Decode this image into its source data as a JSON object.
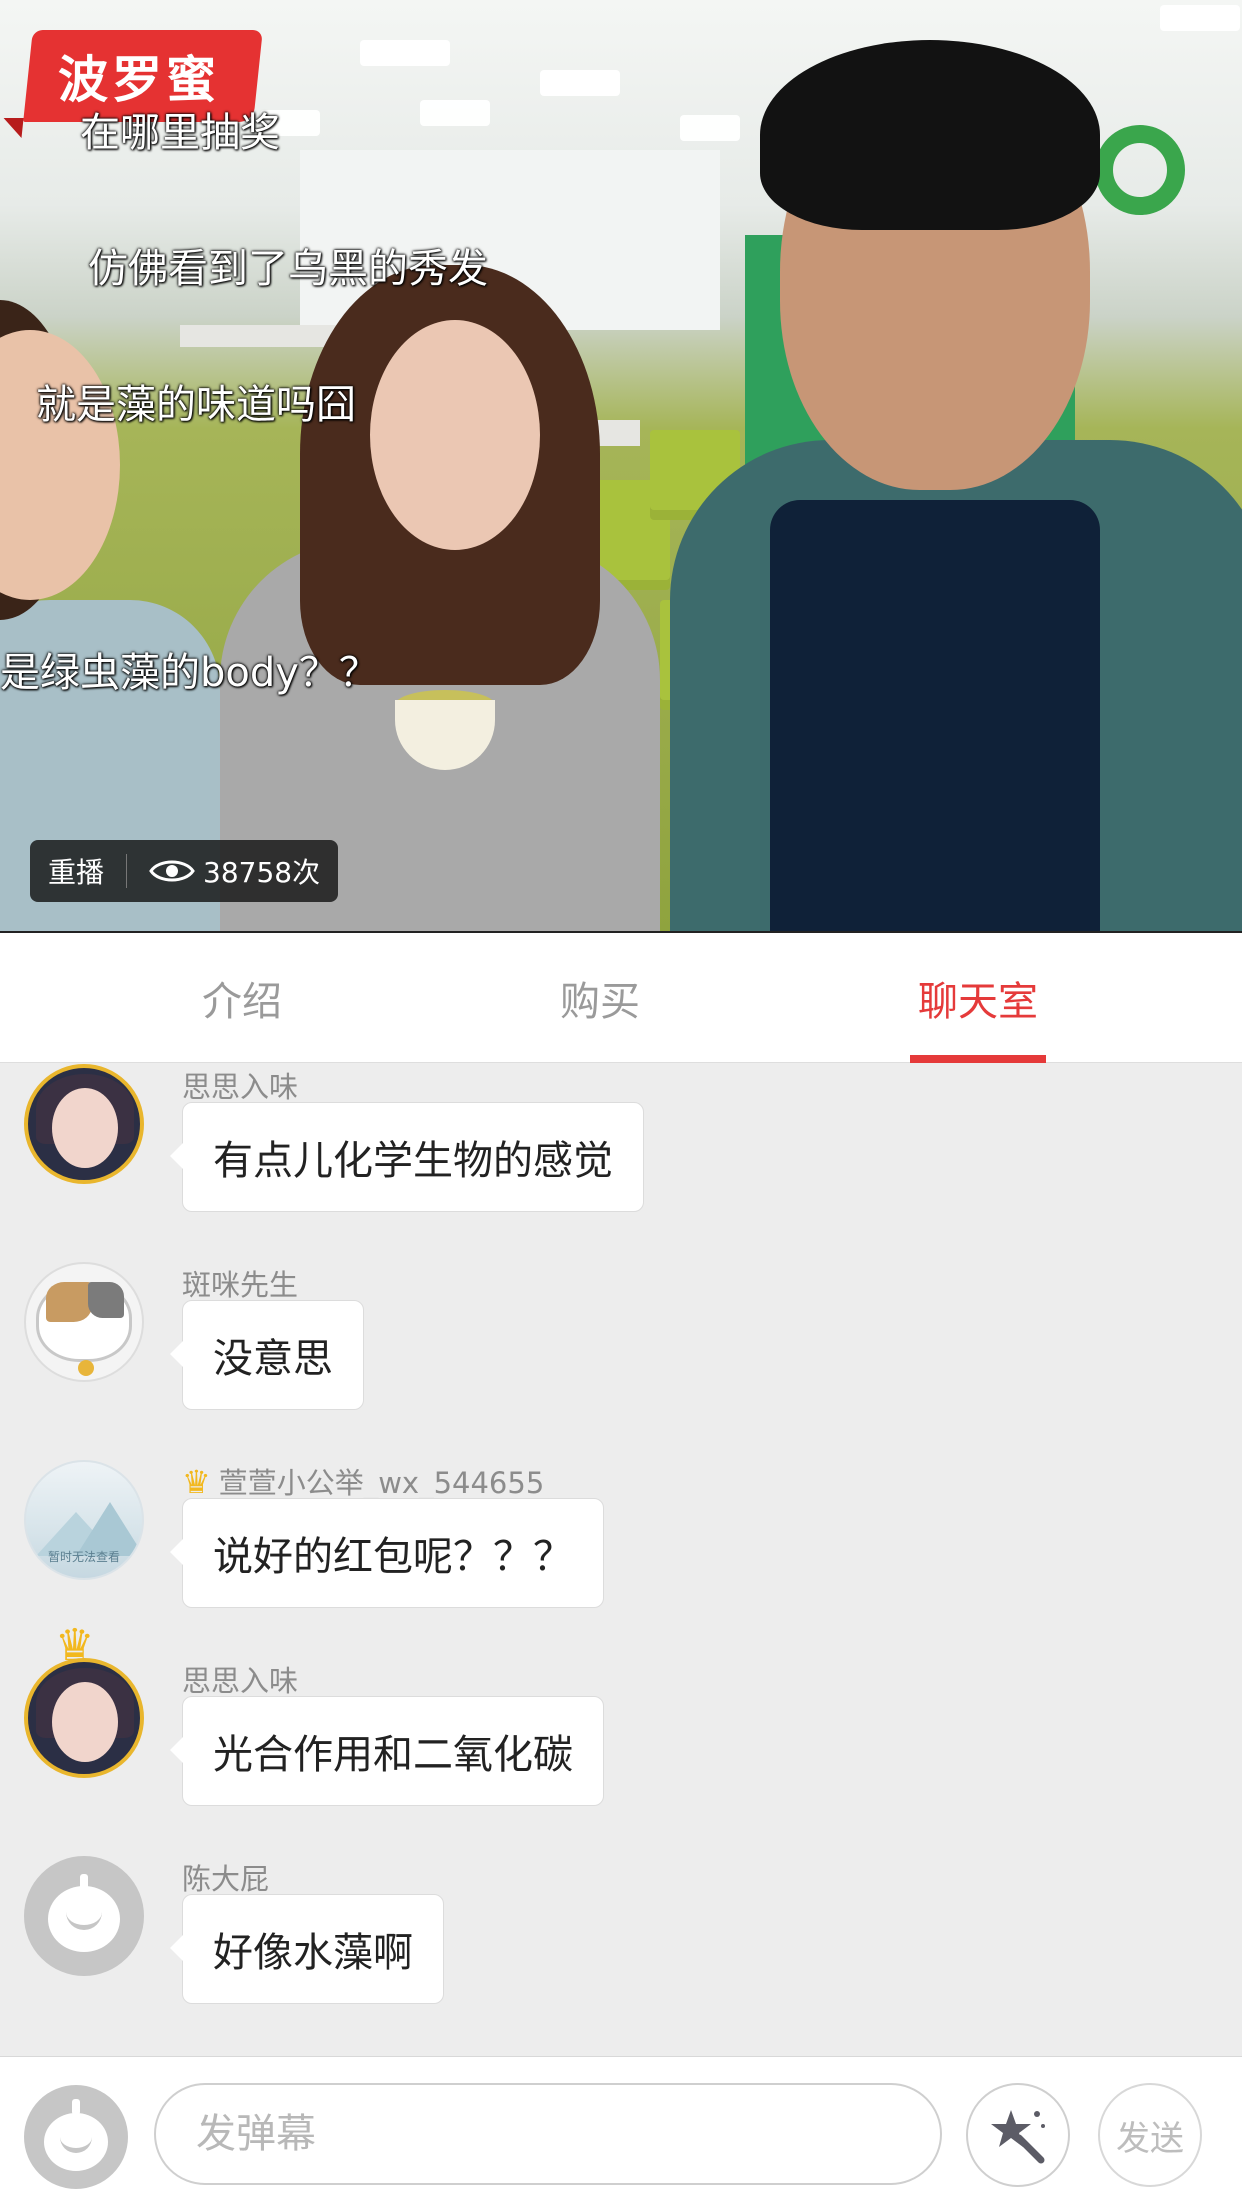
{
  "video": {
    "logo_text": "波罗蜜",
    "danmaku": [
      "在哪里抽奖",
      "仿佛看到了乌黑的秀发",
      "就是藻的味道吗囧",
      "是绿虫藻的body？？"
    ],
    "replay_label": "重播",
    "view_count": "38758次"
  },
  "tabs": [
    {
      "label": "介绍",
      "active": false
    },
    {
      "label": "购买",
      "active": false
    },
    {
      "label": "聊天室",
      "active": true
    }
  ],
  "accent_color": "#e53a3a",
  "chat": {
    "messages": [
      {
        "user": "思思入味",
        "text": "有点儿化学生物的感觉",
        "avatar": "gold-frame-user-avatar"
      },
      {
        "user": "斑咪先生",
        "text": "没意思",
        "avatar": "cat-avatar"
      },
      {
        "user": "萱萱小公举_wx_544655",
        "text": "说好的红包呢？？？",
        "avatar": "placeholder-avatar",
        "placeholder_text": "暂时无法查看",
        "badge": "crown-icon"
      },
      {
        "user": "思思入味",
        "text": "光合作用和二氧化碳",
        "avatar": "gold-frame-user-avatar",
        "badge": "crown-icon"
      },
      {
        "user": "陈大屁",
        "text": "好像水藻啊",
        "avatar": "default-avatar"
      }
    ]
  },
  "input_bar": {
    "placeholder": "发弹幕",
    "send_label": "发送",
    "icons": [
      "default-avatar",
      "magic-wand-icon"
    ]
  }
}
